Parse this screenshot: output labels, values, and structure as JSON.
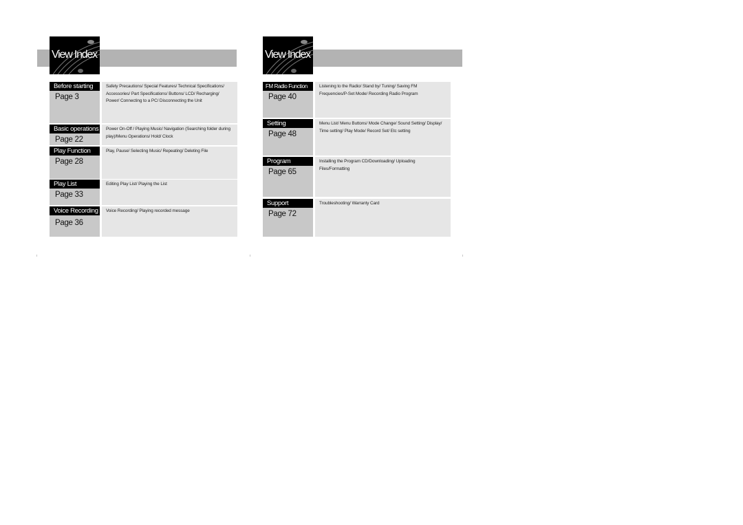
{
  "pages": [
    {
      "header_title": "View Index",
      "sections": [
        {
          "title": "Before starting",
          "page": "Page 3",
          "description": "Safety Precautions/ Special Features/ Technical Specifications/ Accessories/ Part Specifications/ Buttons/ LCD/ Recharging/ Power/ Connecting to a PC/ Disconnecting the Unit"
        },
        {
          "title": "Basic operations",
          "page": "Page 22",
          "description": "Power On-Off / Playing Music/ Navigation (Searching folder during play)/Menu Operations/ Hold/ Clock"
        },
        {
          "title": "Play Function",
          "page": "Page 28",
          "description": "Play, Pause/ Selecting Music/ Repeating/ Deleting File"
        },
        {
          "title": "Play List",
          "page": "Page 33",
          "description": "Editing Play List/ Playing the List"
        },
        {
          "title": "Voice Recording",
          "page": "Page 36",
          "description": "Voice Recording/ Playing recorded message"
        }
      ]
    },
    {
      "header_title": "View Index",
      "sections": [
        {
          "title": "FM Radio Function",
          "page": "Page 40",
          "description": "Listening to the Radio/ Stand by/ Tuning/ Saving FM Frequencies/P-Set Mode/ Recording Radio Program"
        },
        {
          "title": "Setting",
          "page": "Page 48",
          "description": "Menu List/ Menu Buttons/ Mode Change/ Sound Setting/ Display/ Time setting/ Play Mode/ Record Set/ Etc setting"
        },
        {
          "title": "Program",
          "page": "Page 65",
          "description": "Installing the Program CD/Downloading/ Uploading Files/Formatting"
        },
        {
          "title": "Support",
          "page": "Page 72",
          "description": "Troubleshooting/ Warranty Card"
        }
      ]
    }
  ]
}
